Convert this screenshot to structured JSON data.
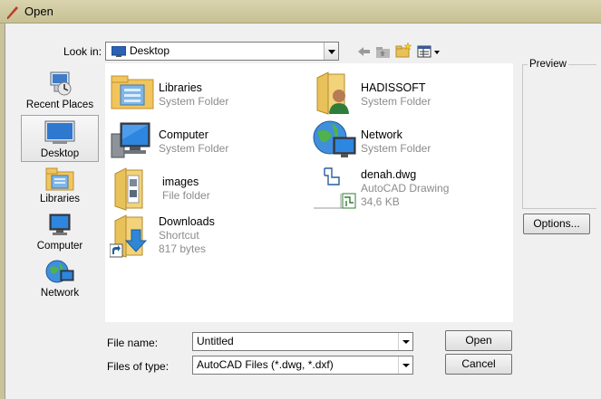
{
  "window": {
    "title": "Open"
  },
  "toolbar": {
    "look_in_label": "Look in:",
    "look_in_value": "Desktop",
    "back_icon": "back-arrow-icon",
    "up_icon": "up-folder-icon",
    "new_folder_icon": "new-folder-icon",
    "view_icon": "view-menu-icon"
  },
  "places": [
    {
      "label": "Recent Places",
      "icon": "recent-places-icon"
    },
    {
      "label": "Desktop",
      "icon": "desktop-icon",
      "selected": true
    },
    {
      "label": "Libraries",
      "icon": "libraries-icon"
    },
    {
      "label": "Computer",
      "icon": "computer-icon"
    },
    {
      "label": "Network",
      "icon": "network-icon"
    }
  ],
  "files": [
    {
      "name": "Libraries",
      "type": "System Folder",
      "icon": "libraries-folder-icon"
    },
    {
      "name": "HADISSOFT",
      "type": "System Folder",
      "icon": "user-folder-icon"
    },
    {
      "name": "Computer",
      "type": "System Folder",
      "icon": "computer-icon"
    },
    {
      "name": "Network",
      "type": "System Folder",
      "icon": "network-icon"
    },
    {
      "name": "images",
      "type": "File folder",
      "icon": "folder-icon"
    },
    {
      "name": "denah.dwg",
      "type": "AutoCAD Drawing",
      "size": "34,6 KB",
      "icon": "dwg-file-icon"
    },
    {
      "name": "Downloads",
      "type": "Shortcut",
      "size": "817 bytes",
      "icon": "downloads-shortcut-icon"
    }
  ],
  "preview": {
    "label": "Preview"
  },
  "options_button": "Options...",
  "file_name": {
    "label": "File name:",
    "value": "Untitled"
  },
  "files_of_type": {
    "label": "Files of type:",
    "value": "AutoCAD Files (*.dwg, *.dxf)"
  },
  "buttons": {
    "open": "Open",
    "cancel": "Cancel"
  },
  "colors": {
    "dialog_bg": "#f0f0f0",
    "titlebar": "#cfc8a0",
    "secondary_text": "#8c8c8c"
  }
}
